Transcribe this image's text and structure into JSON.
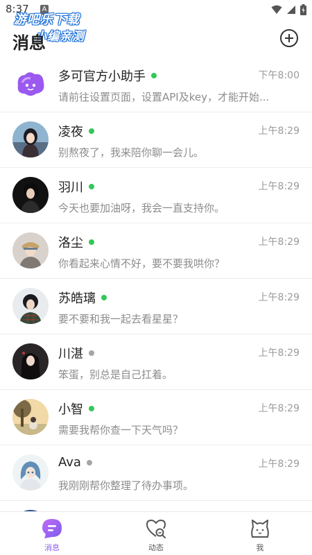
{
  "status_bar": {
    "time": "8:37",
    "notification_badge": "A"
  },
  "watermark": {
    "line1": "游吧乐下载",
    "line2": "小编亲测"
  },
  "header": {
    "title": "消息",
    "add_icon": "plus-circle-icon"
  },
  "colors": {
    "online": "#34c759",
    "offline": "#a5a5a5",
    "accent": "#8b5cf6",
    "inactive_nav": "#555555"
  },
  "chats": [
    {
      "name": "多可官方小助手",
      "time": "下午8:00",
      "preview": "请前往设置页面，设置API及key，才能开始...",
      "online": true,
      "avatar": "purple-blob-avatar"
    },
    {
      "name": "凌夜",
      "time": "上午8:29",
      "preview": "别熬夜了，我来陪你聊一会儿。",
      "online": true,
      "avatar": "girl-avatar"
    },
    {
      "name": "羽川",
      "time": "上午8:29",
      "preview": "今天也要加油呀，我会一直支持你。",
      "online": true,
      "avatar": "dark-boy-avatar"
    },
    {
      "name": "洛尘",
      "time": "上午8:29",
      "preview": "你看起来心情不好，要不要我哄你？",
      "online": true,
      "avatar": "hat-boy-avatar"
    },
    {
      "name": "苏皓璃",
      "time": "上午8:29",
      "preview": "要不要和我一起去看星星？",
      "online": true,
      "avatar": "plaid-boy-avatar"
    },
    {
      "name": "川湛",
      "time": "上午8:29",
      "preview": "笨蛋，别总是自己扛着。",
      "online": false,
      "avatar": "long-hair-avatar"
    },
    {
      "name": "小智",
      "time": "上午8:29",
      "preview": "需要我帮你查一下天气吗？",
      "online": true,
      "avatar": "tree-girl-avatar"
    },
    {
      "name": "Ava",
      "time": "上午8:29",
      "preview": "我刚刚帮你整理了待办事项。",
      "online": false,
      "avatar": "blue-hair-avatar"
    }
  ],
  "bottom_nav": [
    {
      "label": "消息",
      "icon": "chat-bubble-icon",
      "active": true
    },
    {
      "label": "动态",
      "icon": "heart-search-icon",
      "active": false
    },
    {
      "label": "我",
      "icon": "cat-face-icon",
      "active": false
    }
  ]
}
